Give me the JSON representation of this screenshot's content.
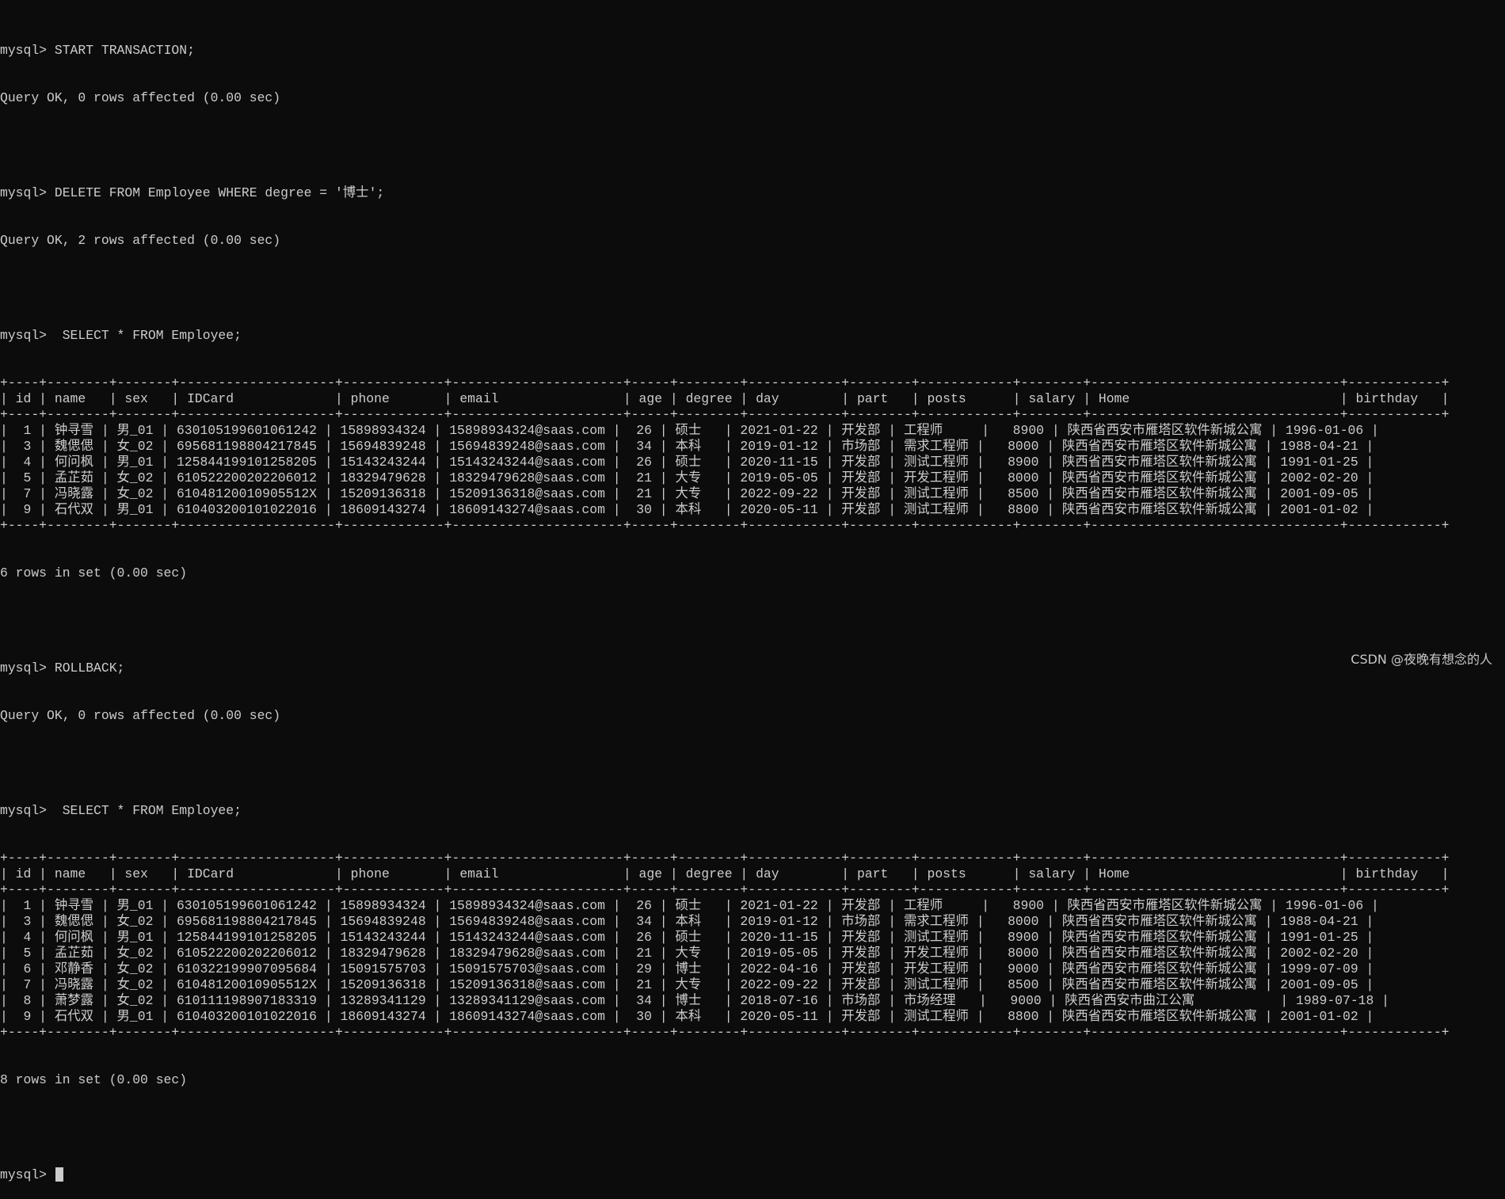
{
  "terminal": {
    "prompt": "mysql> ",
    "cmd1": "START TRANSACTION;",
    "res1": "Query OK, 0 rows affected (0.00 sec)",
    "cmd2": "DELETE FROM Employee WHERE degree = '博士';",
    "res2": "Query OK, 2 rows affected (0.00 sec)",
    "cmd3": " SELECT * FROM Employee;",
    "count1": "6 rows in set (0.00 sec)",
    "cmd4": "ROLLBACK;",
    "res4": "Query OK, 0 rows affected (0.00 sec)",
    "cmd5": " SELECT * FROM Employee;",
    "count2": "8 rows in set (0.00 sec)",
    "final_prompt": "mysql> "
  },
  "columns": [
    "id",
    "name",
    "sex",
    "IDCard",
    "phone",
    "email",
    "age",
    "degree",
    "day",
    "part",
    "posts",
    "salary",
    "Home",
    "birthday"
  ],
  "table1_rows": [
    [
      "1",
      "钟寻雪",
      "男_01",
      "630105199601061242",
      "15898934324",
      "15898934324@saas.com",
      "26",
      "硕士",
      "2021-01-22",
      "开发部",
      "工程师",
      "8900",
      "陕西省西安市雁塔区软件新城公寓",
      "1996-01-06"
    ],
    [
      "3",
      "魏偲偲",
      "女_02",
      "695681198804217845",
      "15694839248",
      "15694839248@saas.com",
      "34",
      "本科",
      "2019-01-12",
      "市场部",
      "需求工程师",
      "8000",
      "陕西省西安市雁塔区软件新城公寓",
      "1988-04-21"
    ],
    [
      "4",
      "何问枫",
      "男_01",
      "125844199101258205",
      "15143243244",
      "15143243244@saas.com",
      "26",
      "硕士",
      "2020-11-15",
      "开发部",
      "测试工程师",
      "8900",
      "陕西省西安市雁塔区软件新城公寓",
      "1991-01-25"
    ],
    [
      "5",
      "孟芷茹",
      "女_02",
      "610522200202206012",
      "18329479628",
      "18329479628@saas.com",
      "21",
      "大专",
      "2019-05-05",
      "开发部",
      "开发工程师",
      "8000",
      "陕西省西安市雁塔区软件新城公寓",
      "2002-02-20"
    ],
    [
      "7",
      "冯晓露",
      "女_02",
      "61048120010905512X",
      "15209136318",
      "15209136318@saas.com",
      "21",
      "大专",
      "2022-09-22",
      "开发部",
      "测试工程师",
      "8500",
      "陕西省西安市雁塔区软件新城公寓",
      "2001-09-05"
    ],
    [
      "9",
      "石代双",
      "男_01",
      "610403200101022016",
      "18609143274",
      "18609143274@saas.com",
      "30",
      "本科",
      "2020-05-11",
      "开发部",
      "测试工程师",
      "8800",
      "陕西省西安市雁塔区软件新城公寓",
      "2001-01-02"
    ]
  ],
  "table2_rows": [
    [
      "1",
      "钟寻雪",
      "男_01",
      "630105199601061242",
      "15898934324",
      "15898934324@saas.com",
      "26",
      "硕士",
      "2021-01-22",
      "开发部",
      "工程师",
      "8900",
      "陕西省西安市雁塔区软件新城公寓",
      "1996-01-06"
    ],
    [
      "3",
      "魏偲偲",
      "女_02",
      "695681198804217845",
      "15694839248",
      "15694839248@saas.com",
      "34",
      "本科",
      "2019-01-12",
      "市场部",
      "需求工程师",
      "8000",
      "陕西省西安市雁塔区软件新城公寓",
      "1988-04-21"
    ],
    [
      "4",
      "何问枫",
      "男_01",
      "125844199101258205",
      "15143243244",
      "15143243244@saas.com",
      "26",
      "硕士",
      "2020-11-15",
      "开发部",
      "测试工程师",
      "8900",
      "陕西省西安市雁塔区软件新城公寓",
      "1991-01-25"
    ],
    [
      "5",
      "孟芷茹",
      "女_02",
      "610522200202206012",
      "18329479628",
      "18329479628@saas.com",
      "21",
      "大专",
      "2019-05-05",
      "开发部",
      "开发工程师",
      "8000",
      "陕西省西安市雁塔区软件新城公寓",
      "2002-02-20"
    ],
    [
      "6",
      "邓静香",
      "女_02",
      "610322199907095684",
      "15091575703",
      "15091575703@saas.com",
      "29",
      "博士",
      "2022-04-16",
      "开发部",
      "开发工程师",
      "9000",
      "陕西省西安市雁塔区软件新城公寓",
      "1999-07-09"
    ],
    [
      "7",
      "冯晓露",
      "女_02",
      "61048120010905512X",
      "15209136318",
      "15209136318@saas.com",
      "21",
      "大专",
      "2022-09-22",
      "开发部",
      "测试工程师",
      "8500",
      "陕西省西安市雁塔区软件新城公寓",
      "2001-09-05"
    ],
    [
      "8",
      "萧梦露",
      "女_02",
      "610111198907183319",
      "13289341129",
      "13289341129@saas.com",
      "34",
      "博士",
      "2018-07-16",
      "市场部",
      "市场经理",
      "9000",
      "陕西省西安市曲江公寓",
      "1989-07-18"
    ],
    [
      "9",
      "石代双",
      "男_01",
      "610403200101022016",
      "18609143274",
      "18609143274@saas.com",
      "30",
      "本科",
      "2020-05-11",
      "开发部",
      "测试工程师",
      "8800",
      "陕西省西安市雁塔区软件新城公寓",
      "2001-01-02"
    ]
  ],
  "watermark": "CSDN @夜晚有想念的人"
}
